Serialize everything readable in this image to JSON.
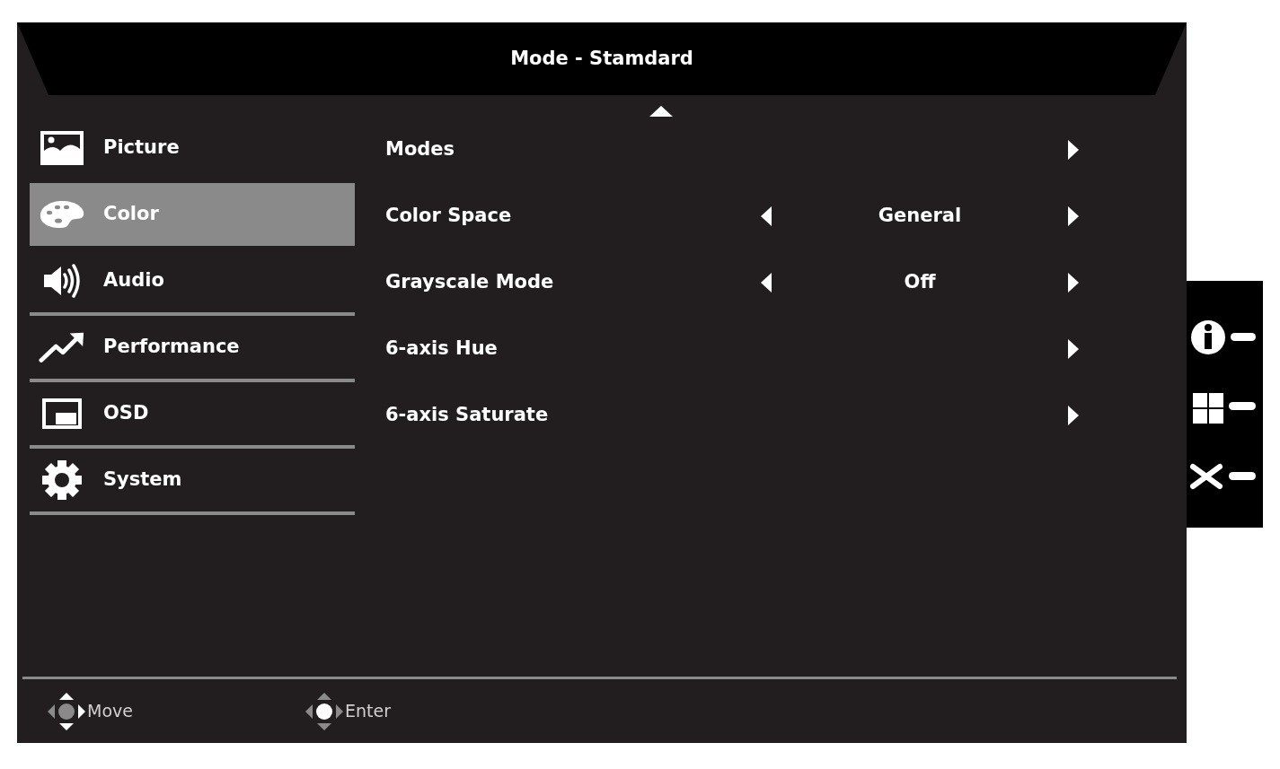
{
  "header": {
    "title": "Mode - Stamdard"
  },
  "menu": [
    {
      "kind": "picture",
      "label": "Picture",
      "selected": false,
      "underlined": false
    },
    {
      "kind": "palette",
      "label": "Color",
      "selected": true,
      "underlined": false
    },
    {
      "kind": "speaker",
      "label": "Audio",
      "selected": false,
      "underlined": true
    },
    {
      "kind": "trend",
      "label": "Performance",
      "selected": false,
      "underlined": true
    },
    {
      "kind": "osd",
      "label": "OSD",
      "selected": false,
      "underlined": true
    },
    {
      "kind": "gear",
      "label": "System",
      "selected": false,
      "underlined": true
    }
  ],
  "settings": [
    {
      "kind": "submenu",
      "label": "Modes"
    },
    {
      "kind": "choice",
      "label": "Color Space",
      "value": "General"
    },
    {
      "kind": "choice",
      "label": "Grayscale Mode",
      "value": "Off"
    },
    {
      "kind": "submenu",
      "label": "6-axis Hue"
    },
    {
      "kind": "submenu",
      "label": "6-axis Saturate"
    }
  ],
  "hints": [
    {
      "kind": "move",
      "label": "Move"
    },
    {
      "kind": "enter",
      "label": "Enter"
    }
  ]
}
